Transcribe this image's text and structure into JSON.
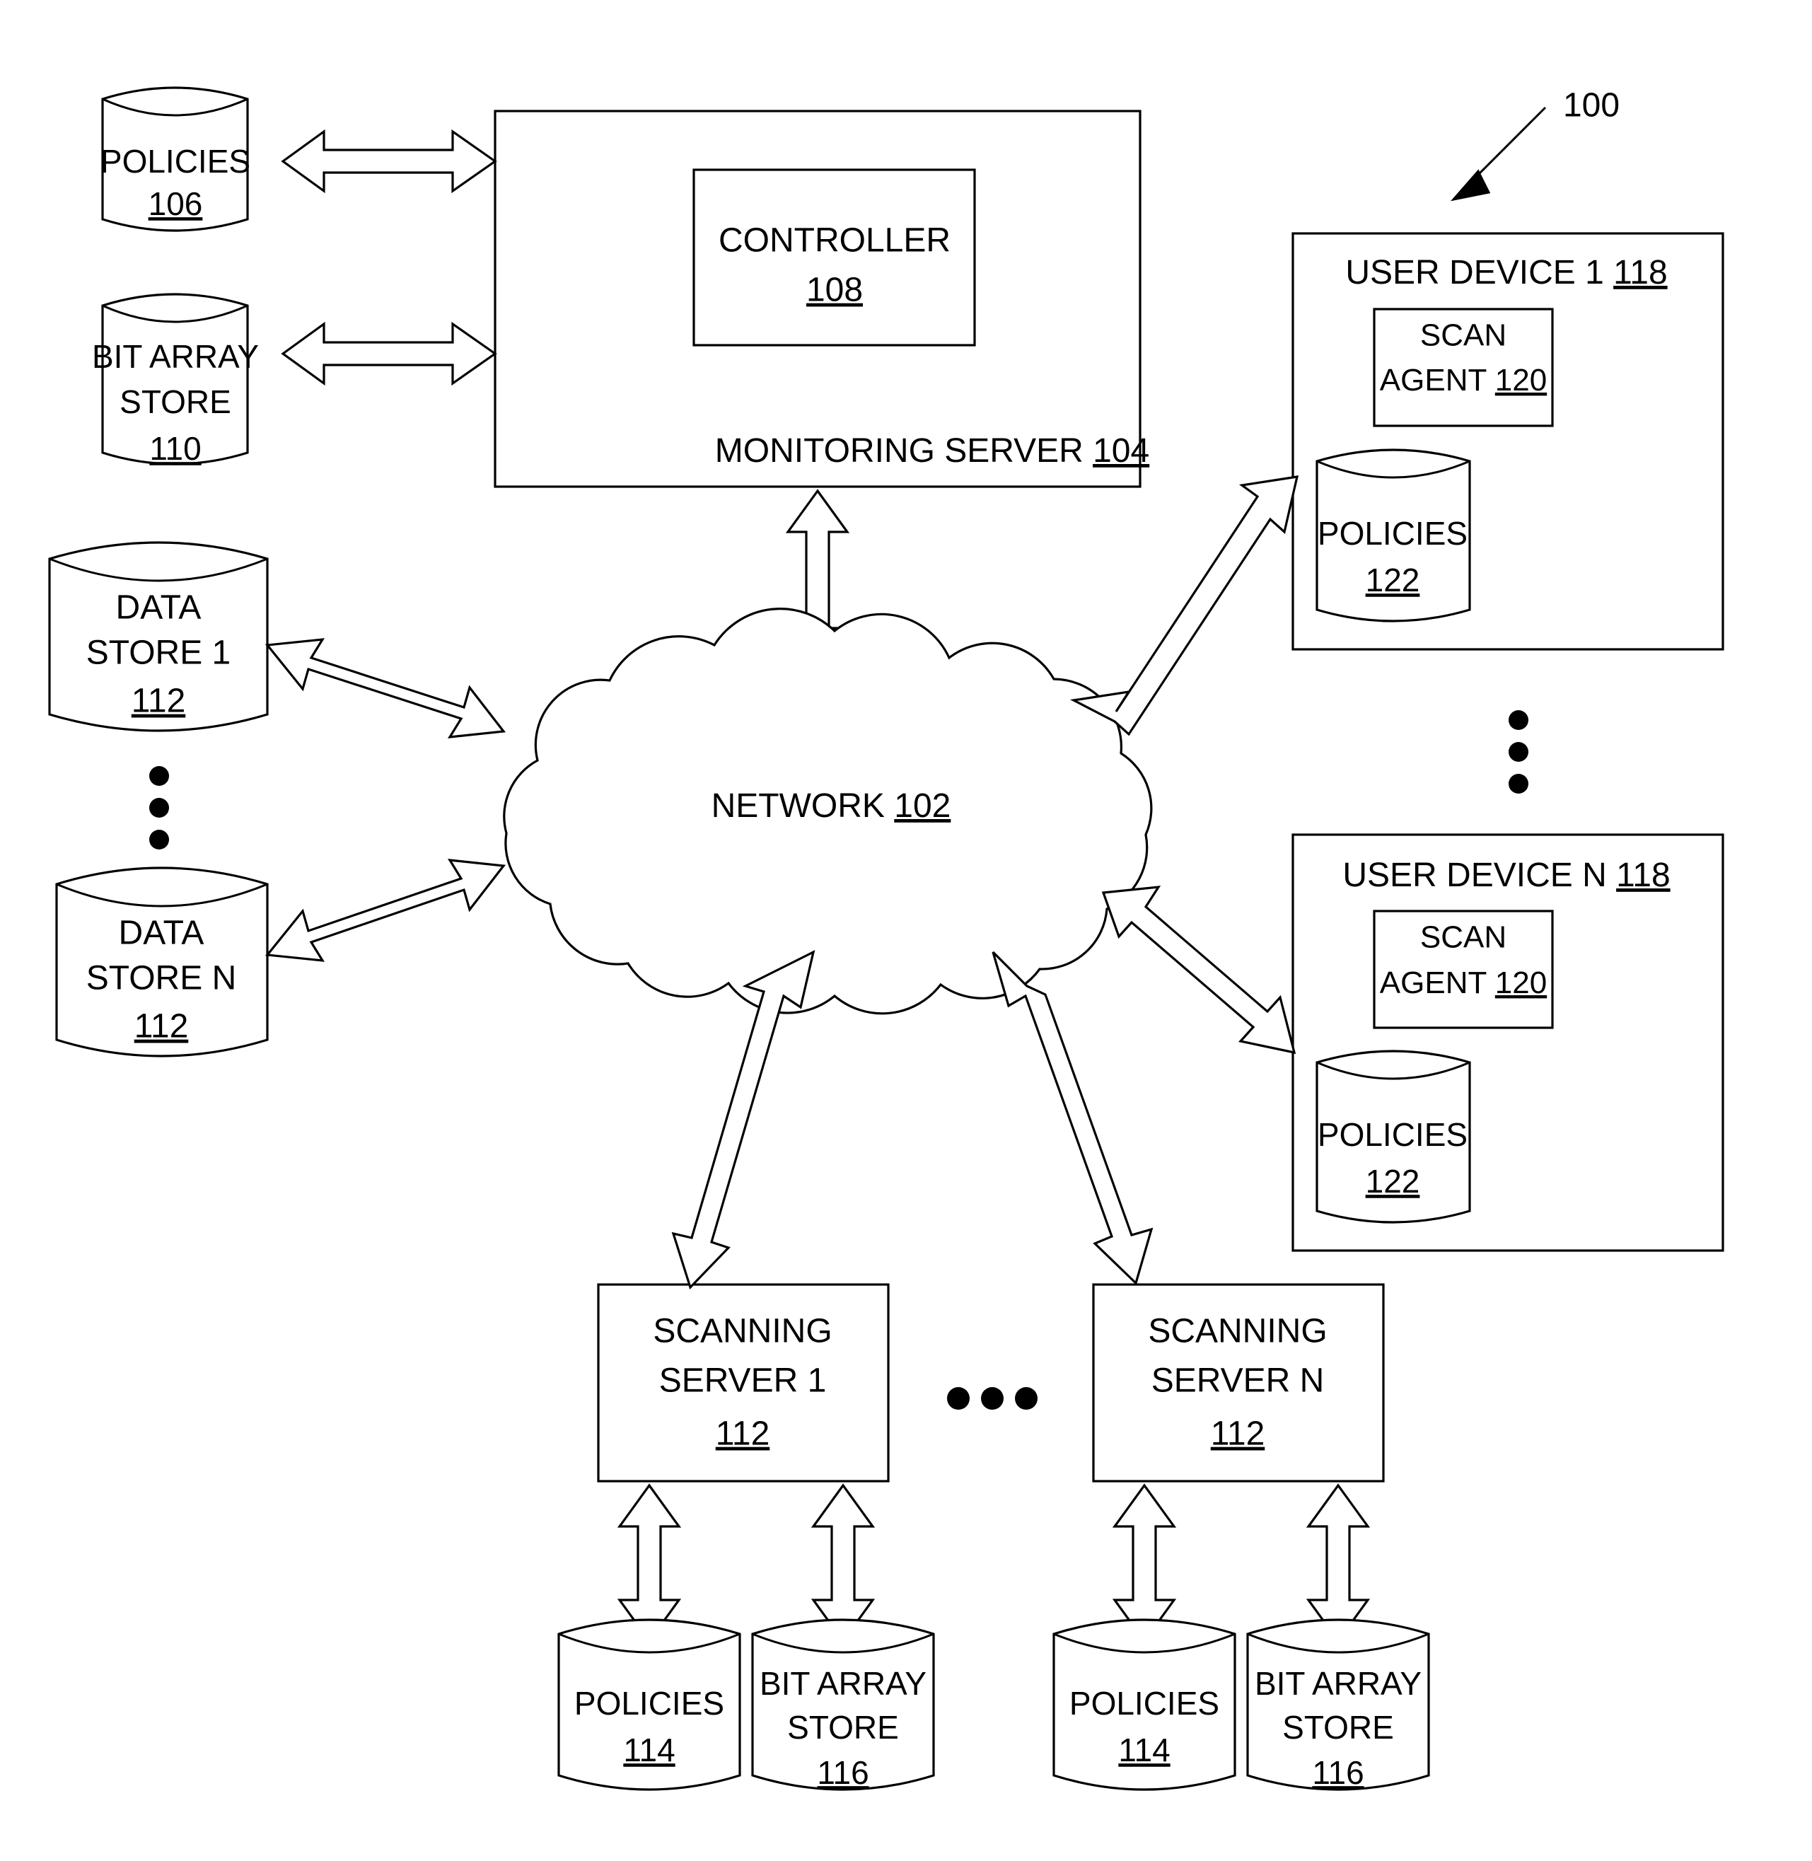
{
  "figure": {
    "reference_label": "100",
    "title_hidden": ""
  },
  "nodes": {
    "policies_106": {
      "line1": "POLICIES",
      "ref": "106",
      "type": "cylinder"
    },
    "bit_array_store_110": {
      "line1": "BIT ARRAY",
      "line2": "STORE",
      "ref": "110",
      "type": "cylinder"
    },
    "data_store_1": {
      "line1": "DATA",
      "line2": "STORE 1",
      "ref": "112",
      "type": "cylinder"
    },
    "data_store_n": {
      "line1": "DATA",
      "line2": "STORE N",
      "ref": "112",
      "type": "cylinder"
    },
    "monitoring_server": {
      "label": "MONITORING SERVER",
      "ref": "104",
      "type": "box"
    },
    "controller": {
      "label": "CONTROLLER",
      "ref": "108",
      "type": "box"
    },
    "network": {
      "label": "NETWORK",
      "ref": "102",
      "type": "cloud"
    },
    "user_device_1": {
      "label": "USER DEVICE 1",
      "ref": "118",
      "type": "box"
    },
    "user_device_n": {
      "label": "USER DEVICE N",
      "ref": "118",
      "type": "box"
    },
    "scan_agent_1": {
      "line1": "SCAN",
      "line2": "AGENT",
      "ref": "120",
      "type": "box"
    },
    "scan_agent_n": {
      "line1": "SCAN",
      "line2": "AGENT",
      "ref": "120",
      "type": "box"
    },
    "policies_122_a": {
      "line1": "POLICIES",
      "ref": "122",
      "type": "cylinder"
    },
    "policies_122_b": {
      "line1": "POLICIES",
      "ref": "122",
      "type": "cylinder"
    },
    "scanning_server_1": {
      "line1": "SCANNING",
      "line2": "SERVER 1",
      "ref": "112",
      "type": "box"
    },
    "scanning_server_n": {
      "line1": "SCANNING",
      "line2": "SERVER N",
      "ref": "112",
      "type": "box"
    },
    "policies_114_a": {
      "line1": "POLICIES",
      "ref": "114",
      "type": "cylinder"
    },
    "bit_array_store_116_a": {
      "line1": "BIT ARRAY",
      "line2": "STORE",
      "ref": "116",
      "type": "cylinder"
    },
    "policies_114_b": {
      "line1": "POLICIES",
      "ref": "114",
      "type": "cylinder"
    },
    "bit_array_store_116_b": {
      "line1": "BIT ARRAY",
      "line2": "STORE",
      "ref": "116",
      "type": "cylinder"
    }
  },
  "ellipses": {
    "data_stores_vertical": "vertical-ellipsis",
    "user_devices_vertical": "vertical-ellipsis",
    "scanning_servers_horizontal": "horizontal-ellipsis"
  },
  "connectors": [
    {
      "name": "policies106-to-monitoring-server",
      "style": "double-headed-hollow"
    },
    {
      "name": "bitarraystore110-to-monitoring-server",
      "style": "double-headed-hollow"
    },
    {
      "name": "datastore1-to-network",
      "style": "double-headed-hollow"
    },
    {
      "name": "datastoren-to-network",
      "style": "double-headed-hollow"
    },
    {
      "name": "monitoring-server-to-network",
      "style": "double-headed-hollow"
    },
    {
      "name": "network-to-userdevice1",
      "style": "double-headed-hollow"
    },
    {
      "name": "network-to-userdevicen",
      "style": "double-headed-hollow"
    },
    {
      "name": "network-to-scanningserver1",
      "style": "double-headed-hollow"
    },
    {
      "name": "network-to-scanningservern",
      "style": "double-headed-hollow"
    },
    {
      "name": "scanningserver1-to-policies114",
      "style": "double-headed-hollow"
    },
    {
      "name": "scanningserver1-to-bitarraystore116",
      "style": "double-headed-hollow"
    },
    {
      "name": "scanningservern-to-policies114",
      "style": "double-headed-hollow"
    },
    {
      "name": "scanningservern-to-bitarraystore116",
      "style": "double-headed-hollow"
    },
    {
      "name": "figure-lead-line-100",
      "style": "solid-head"
    }
  ],
  "colors": {
    "ink": "#000000",
    "paper": "#ffffff"
  }
}
